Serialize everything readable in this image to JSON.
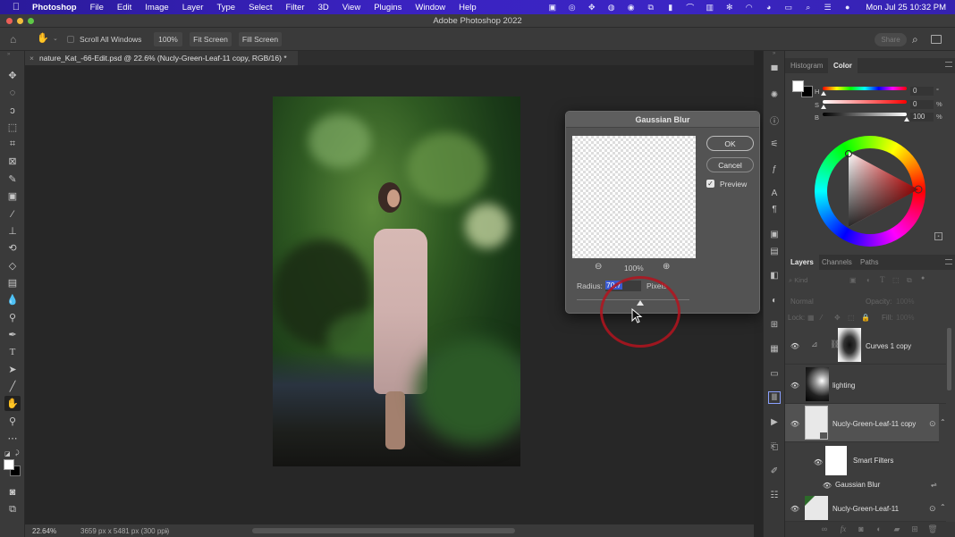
{
  "menubar": {
    "app_name": "Photoshop",
    "menus": [
      "File",
      "Edit",
      "Image",
      "Layer",
      "Type",
      "Select",
      "Filter",
      "3D",
      "View",
      "Plugins",
      "Window",
      "Help"
    ],
    "status_icons": [
      "screen-record-icon",
      "creative-cloud-icon",
      "dropbox-icon",
      "globe-icon",
      "screencast-icon",
      "airplay-icon",
      "bookmark-icon",
      "arc-icon",
      "layout-icon",
      "bluetooth-icon",
      "wifi-icon",
      "user-icon",
      "display-icon",
      "spotlight-icon",
      "control-center-icon",
      "siri-icon"
    ],
    "clock": "Mon Jul 25  10:32 PM"
  },
  "window": {
    "title": "Adobe Photoshop 2022"
  },
  "options_bar": {
    "scroll_all_label": "Scroll All Windows",
    "scroll_all_checked": false,
    "zoom_100_label": "100%",
    "fit_screen_label": "Fit Screen",
    "fill_screen_label": "Fill Screen",
    "share_label": "Share"
  },
  "document": {
    "tab_title": "nature_Kat_-66-Edit.psd @ 22.6% (Nucly-Green-Leaf-11 copy, RGB/16) *"
  },
  "tools": [
    "move",
    "marquee",
    "lasso",
    "object-selection",
    "crop",
    "frame",
    "eyedropper",
    "healing-brush",
    "brush",
    "clone-stamp",
    "history-brush",
    "eraser",
    "gradient",
    "blur",
    "dodge",
    "pen",
    "type",
    "path-selection",
    "line",
    "hand",
    "zoom",
    "more-tools"
  ],
  "active_tool": "hand",
  "status_bar": {
    "zoom": "22.64%",
    "doc_info": "3659 px x 5481 px (300 ppi)",
    "arrow": "›"
  },
  "dialog": {
    "title": "Gaussian Blur",
    "ok_label": "OK",
    "cancel_label": "Cancel",
    "preview_label": "Preview",
    "preview_checked": true,
    "zoom_level": "100%",
    "radius_label": "Radius:",
    "radius_value": "70.7",
    "radius_unit": "Pixels",
    "slider_fraction": 0.56
  },
  "color_panel": {
    "tabs": [
      "Histogram",
      "Color"
    ],
    "active_tab": "Color",
    "h_label": "H",
    "h_value": "0",
    "h_unit": "°",
    "s_label": "S",
    "s_value": "0",
    "s_unit": "%",
    "b_label": "B",
    "b_value": "100",
    "b_unit": "%",
    "foreground": "#ffffff",
    "background": "#000000"
  },
  "layers_panel": {
    "tabs": [
      "Layers",
      "Channels",
      "Paths"
    ],
    "active_tab": "Layers",
    "filter_placeholder": "Kind",
    "blend_mode": "Normal",
    "opacity_label": "Opacity:",
    "opacity_value": "100%",
    "lock_label": "Lock:",
    "fill_label": "Fill:",
    "fill_value": "100%",
    "layers": [
      {
        "name": "Curves 1 copy",
        "visible": true,
        "type": "adjustment"
      },
      {
        "name": "lighting",
        "visible": true,
        "type": "pixel"
      },
      {
        "name": "Nucly-Green-Leaf-11 copy",
        "visible": true,
        "type": "smart-object",
        "selected": true
      },
      {
        "name": "Smart Filters",
        "visible": true,
        "type": "smart-filters"
      },
      {
        "name": "Gaussian Blur",
        "visible": true,
        "type": "filter"
      },
      {
        "name": "Nucly-Green-Leaf-11",
        "visible": true,
        "type": "smart-object"
      }
    ]
  }
}
